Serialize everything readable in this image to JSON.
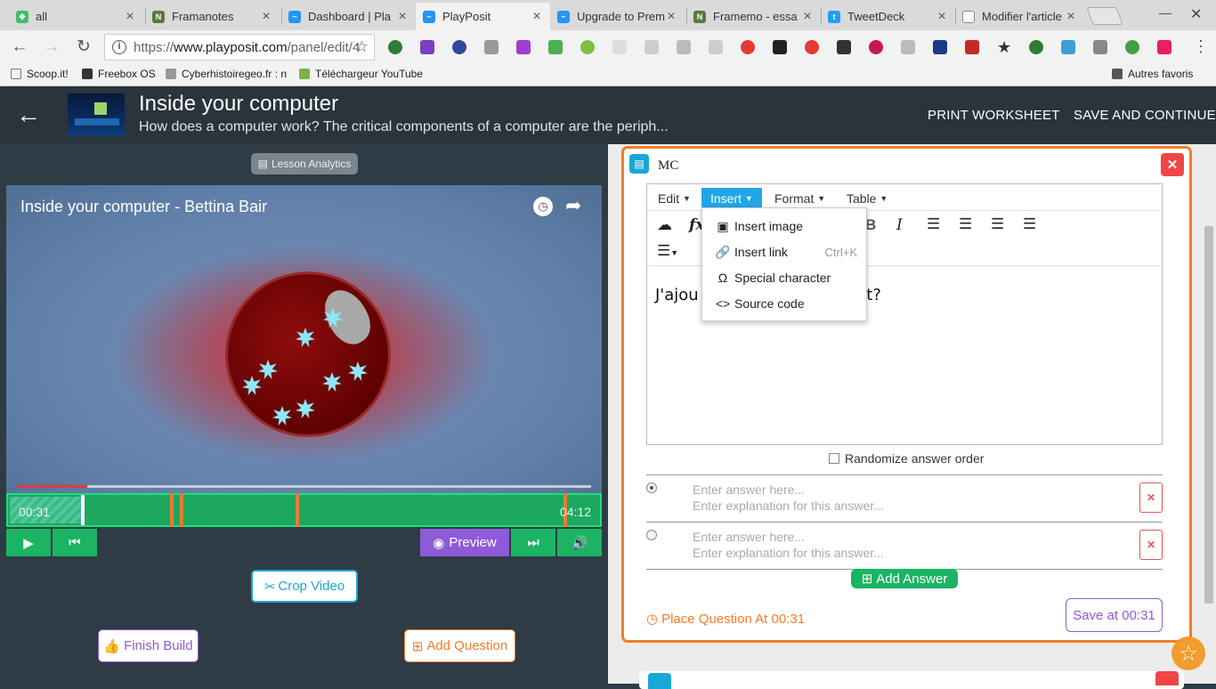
{
  "browser": {
    "tabs": [
      {
        "title": "all",
        "color": "#3dbf6a"
      },
      {
        "title": "Framanotes",
        "color": "#5a7a3a"
      },
      {
        "title": "Dashboard | Pla",
        "color": "#2196f3"
      },
      {
        "title": "PlayPosit",
        "color": "#2196f3"
      },
      {
        "title": "Upgrade to Prem",
        "color": "#2196f3"
      },
      {
        "title": "Framemo - essa",
        "color": "#5a7a3a"
      },
      {
        "title": "TweetDeck",
        "color": "#1da1f2"
      },
      {
        "title": "Modifier l'article",
        "color": "#888888"
      }
    ],
    "url_scheme": "https://",
    "url_host": "www.playposit.com",
    "url_path": "/panel/edit/4",
    "bookmarks": [
      "Scoop.it!",
      "Freebox OS",
      "Cyberhistoiregeo.fr : n",
      "Téléchargeur YouTube",
      "Autres favoris"
    ]
  },
  "header": {
    "title": "Inside your computer",
    "description": "How does a computer work? The critical components of a computer are the periph...",
    "print_label": "PRINT WORKSHEET",
    "save_label": "SAVE AND CONTINUE"
  },
  "left": {
    "analytics_label": "Lesson Analytics",
    "video_title": "Inside your computer - Bettina Bair",
    "time_start": "00:31",
    "time_end": "04:12",
    "progress_fraction": 0.123,
    "question_marks": [
      0.273,
      0.29,
      0.486,
      0.939
    ],
    "preview_label": "Preview",
    "crop_label": "Crop Video",
    "finish_label": "Finish Build",
    "add_question_label": "Add Question"
  },
  "question": {
    "type_label": "MC",
    "menus": [
      "Edit",
      "Insert",
      "Format",
      "Table"
    ],
    "insert_menu": [
      {
        "label": "Insert image",
        "shortcut": ""
      },
      {
        "label": "Insert link",
        "shortcut": "Ctrl+K"
      },
      {
        "label": "Special character",
        "shortcut": ""
      },
      {
        "label": "Source code",
        "shortcut": ""
      }
    ],
    "text_visible_left": "J'ajou",
    "text_visible_right": "mment?",
    "randomize_label": "Randomize answer order",
    "answer_placeholder": "Enter answer here...",
    "explanation_placeholder": "Enter explanation for this answer...",
    "add_answer_label": "Add Answer",
    "place_question_label": "Place Question At 00:31",
    "save_at_label": "Save at 00:31"
  },
  "colors": {
    "accent_orange": "#f47c28",
    "accent_green": "#1ab463",
    "accent_purple": "#8e5bd8",
    "accent_blue": "#21a7e8"
  }
}
